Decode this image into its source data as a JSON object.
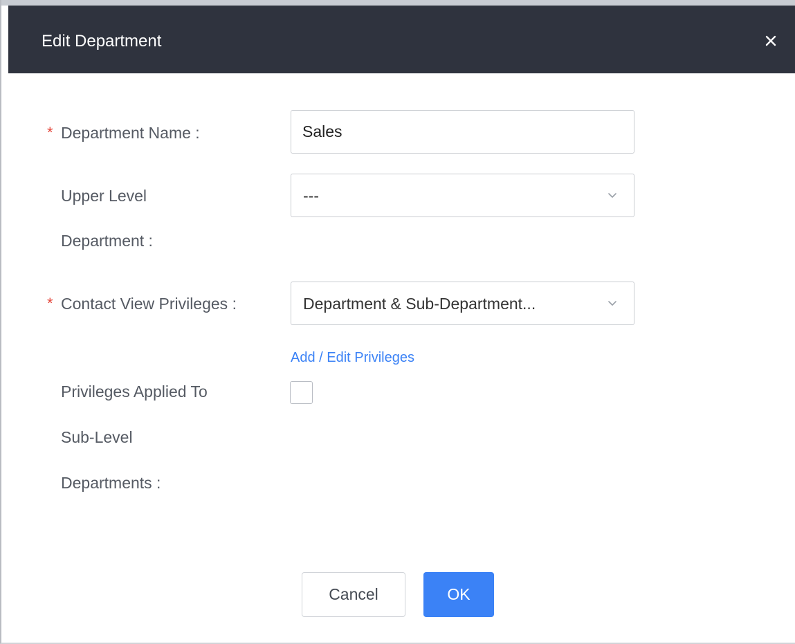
{
  "dialog": {
    "title": "Edit Department",
    "close_icon": "close-icon"
  },
  "form": {
    "required_mark": "*",
    "department_name": {
      "label": "Department Name :",
      "value": "Sales",
      "required": true
    },
    "upper_level_department": {
      "label_line1": "Upper Level",
      "label_line2": "Department :",
      "value": "---",
      "required": false
    },
    "contact_view_privileges": {
      "label": "Contact View Privileges :",
      "value": "Department & Sub-Department...",
      "required": true,
      "link": "Add / Edit Privileges"
    },
    "privileges_applied": {
      "label_line1": "Privileges Applied To",
      "label_line2": "Sub-Level",
      "label_line3": "Departments :",
      "checked": false
    }
  },
  "buttons": {
    "cancel": "Cancel",
    "ok": "OK"
  },
  "colors": {
    "header_bg": "#2f333e",
    "accent": "#3b82f6",
    "required": "#e4453a"
  }
}
